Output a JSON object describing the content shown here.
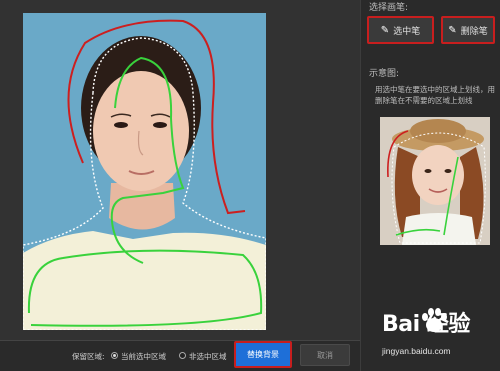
{
  "right_panel": {
    "select_pen_title": "选择画笔:",
    "select_pen_button": "选中笔",
    "erase_pen_button": "删除笔",
    "example_title": "示意图:",
    "hint": "用选中笔在要选中的区域上划线，用删除笔在不需要的区域上划线"
  },
  "bottom_bar": {
    "keep_region_label": "保留区域:",
    "option_current": "当前选中区域",
    "option_non_selected": "非选中区域",
    "selected_option": "当前选中区域",
    "replace_button": "替换背景",
    "cancel_button": "取消"
  },
  "watermark": {
    "logo": "Bai 经验",
    "url": "jingyan.baidu.com"
  },
  "icons": {
    "select_pen": "pen-icon",
    "erase_pen": "eraser-pen-icon",
    "paw": "baidu-paw-icon"
  },
  "colors": {
    "highlight_border": "#c81e1e",
    "primary_button": "#1e6fd8",
    "photo_background": "#6aa9c8",
    "select_stroke": "#39d23c",
    "erase_stroke": "#cc1f1f"
  }
}
